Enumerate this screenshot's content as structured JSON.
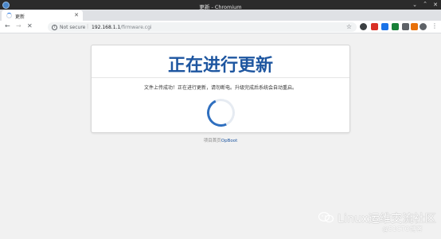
{
  "window": {
    "title": "更新 - Chromium"
  },
  "tabs": [
    {
      "label": "更新"
    }
  ],
  "toolbar": {
    "security_label": "Not secure",
    "separator": "|",
    "url_host": "192.168.1.1",
    "url_path": "/firmware.cgi"
  },
  "extensions": {
    "colors": [
      "#d93025",
      "#1a73e8",
      "#188038",
      "#5f6368",
      "#e8710a"
    ]
  },
  "page": {
    "heading": "正在进行更新",
    "message": "文件上传成功！正在进行更新，请勿断电。升级完成后系统会自动重启。",
    "footer_prefix": "项目首页",
    "footer_link": "OpBoot"
  },
  "watermark": {
    "text": "Linux运维交流社区",
    "sub": "@51CTO博客",
    "icon": "wechat-icon"
  },
  "colors": {
    "heading": "#1e56a0",
    "loader": "#2f6fbf",
    "titlebar": "#2b2b2b"
  }
}
